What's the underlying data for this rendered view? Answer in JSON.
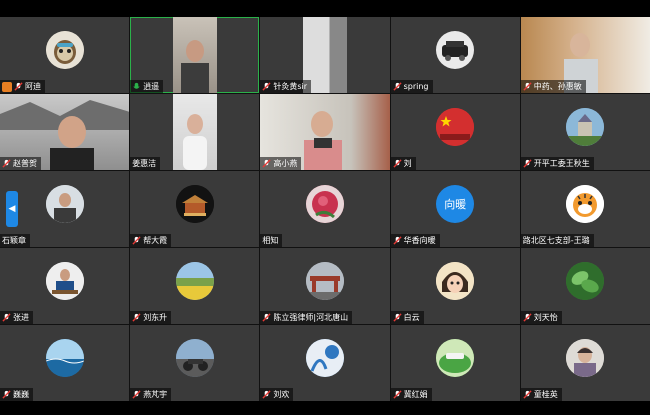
{
  "participants": [
    {
      "name": "阿迪",
      "avatar": "sloth-avatar",
      "status": "muted"
    },
    {
      "name": "逍遥",
      "avatar": "video",
      "status": "speaking"
    },
    {
      "name": "针灸黄sir",
      "avatar": "video",
      "status": "muted"
    },
    {
      "name": "spring",
      "avatar": "car-avatar",
      "status": "muted"
    },
    {
      "name": "中药、孙惠敏",
      "avatar": "video",
      "status": "muted"
    },
    {
      "name": "赵普贺",
      "avatar": "video",
      "status": "muted"
    },
    {
      "name": "姜惠洁",
      "avatar": "video",
      "status": "none"
    },
    {
      "name": "高小燕",
      "avatar": "video",
      "status": "muted"
    },
    {
      "name": "刘",
      "avatar": "flag-avatar",
      "status": "muted"
    },
    {
      "name": "开平工委王秋生",
      "avatar": "castle-avatar",
      "status": "muted"
    },
    {
      "name": "石颖章",
      "avatar": "man-avatar",
      "status": "none"
    },
    {
      "name": "帮大霞",
      "avatar": "temple-avatar",
      "status": "muted"
    },
    {
      "name": "相知",
      "avatar": "flower-avatar",
      "status": "none"
    },
    {
      "name": "华香向暖",
      "avatar": "text-avatar",
      "avatar_text": "向暖",
      "status": "muted"
    },
    {
      "name": "路北区七支部-王璐",
      "avatar": "tiger-avatar",
      "status": "none"
    },
    {
      "name": "张进",
      "avatar": "desk-avatar",
      "status": "muted"
    },
    {
      "name": "刘东升",
      "avatar": "field-avatar",
      "status": "muted"
    },
    {
      "name": "陈立强律师|河北唐山",
      "avatar": "gate-avatar",
      "status": "muted"
    },
    {
      "name": "白云",
      "avatar": "cartoon-avatar",
      "status": "muted"
    },
    {
      "name": "刘天怡",
      "avatar": "leaf-avatar",
      "status": "muted"
    },
    {
      "name": "巍巍",
      "avatar": "sea-avatar",
      "status": "muted"
    },
    {
      "name": "燕芃宇",
      "avatar": "motorbike-avatar",
      "status": "muted"
    },
    {
      "name": "刘欢",
      "avatar": "art-avatar",
      "status": "muted"
    },
    {
      "name": "冀红娟",
      "avatar": "green-avatar",
      "status": "muted"
    },
    {
      "name": "童桂英",
      "avatar": "woman-avatar",
      "status": "muted"
    }
  ],
  "colors": {
    "speaking": "#2bb14a",
    "muted": "#e53935",
    "accent": "#1e88e5"
  }
}
